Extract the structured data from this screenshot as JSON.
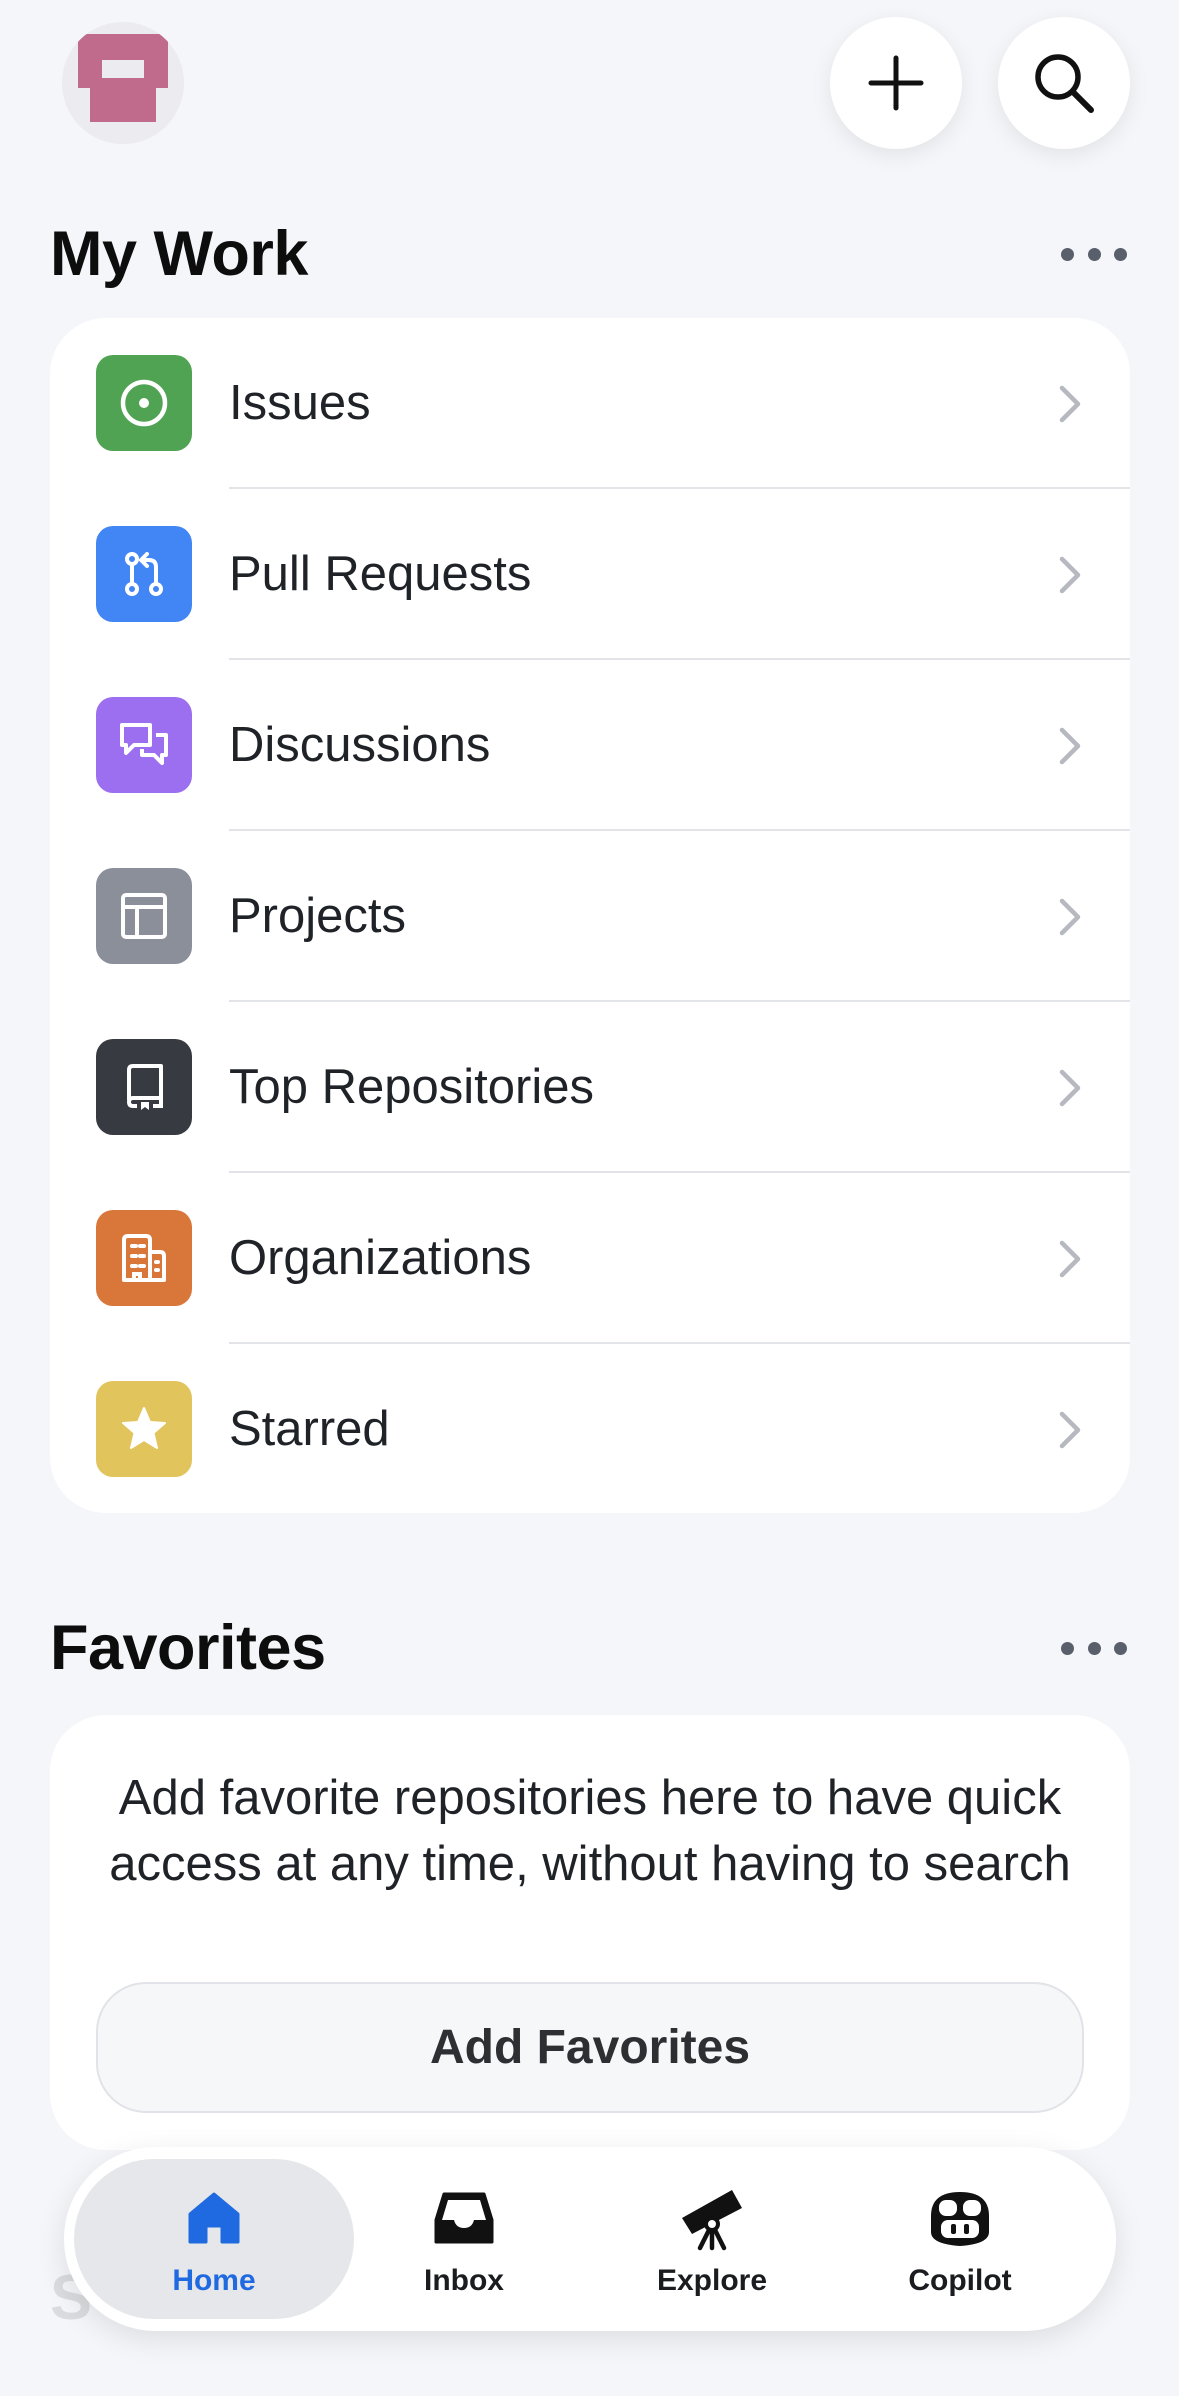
{
  "header": {
    "avatar_icon": "identicon-avatar",
    "new_button_icon": "plus-icon",
    "search_button_icon": "search-icon"
  },
  "my_work": {
    "title": "My Work",
    "items": [
      {
        "label": "Issues",
        "icon": "issue-opened-icon",
        "color": "#4fa353"
      },
      {
        "label": "Pull Requests",
        "icon": "git-pull-request-icon",
        "color": "#4285f4"
      },
      {
        "label": "Discussions",
        "icon": "comment-discussion-icon",
        "color": "#9b6ff0"
      },
      {
        "label": "Projects",
        "icon": "table-icon",
        "color": "#8a8f9a"
      },
      {
        "label": "Top Repositories",
        "icon": "repo-icon",
        "color": "#373a41"
      },
      {
        "label": "Organizations",
        "icon": "organization-icon",
        "color": "#d9773a"
      },
      {
        "label": "Starred",
        "icon": "star-icon",
        "color": "#e2c45c"
      }
    ]
  },
  "favorites": {
    "title": "Favorites",
    "empty_text": "Add favorite repositories here to have quick access at any time, without having to search",
    "button_label": "Add Favorites"
  },
  "tab_bar": {
    "tabs": [
      {
        "label": "Home",
        "icon": "home-icon",
        "active": true
      },
      {
        "label": "Inbox",
        "icon": "inbox-icon",
        "active": false
      },
      {
        "label": "Explore",
        "icon": "telescope-icon",
        "active": false
      },
      {
        "label": "Copilot",
        "icon": "copilot-icon",
        "active": false
      }
    ]
  },
  "colors": {
    "accent": "#1f6ae0",
    "background": "#f5f6f9",
    "avatar": "#c06b8c"
  }
}
